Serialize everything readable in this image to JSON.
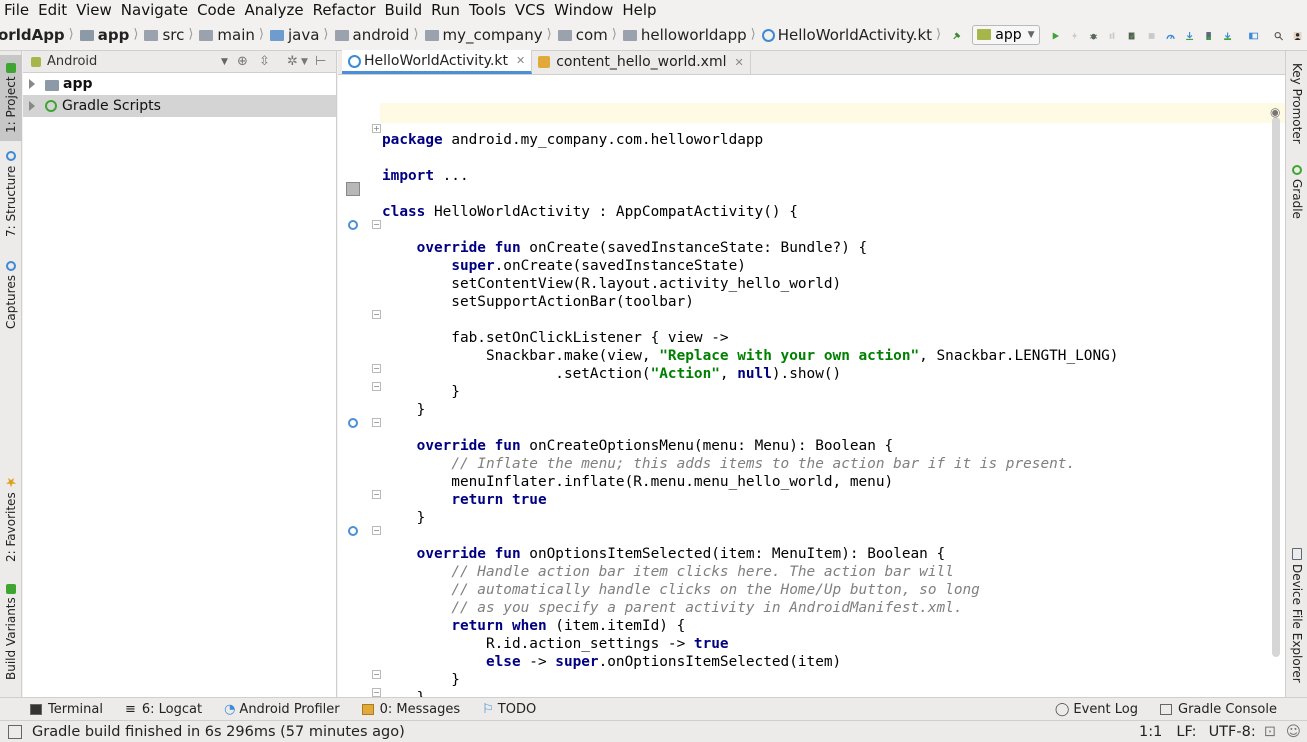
{
  "menu": [
    "File",
    "Edit",
    "View",
    "Navigate",
    "Code",
    "Analyze",
    "Refactor",
    "Build",
    "Run",
    "Tools",
    "VCS",
    "Window",
    "Help"
  ],
  "breadcrumb": [
    {
      "label": "orldApp",
      "icon": "none"
    },
    {
      "label": "app",
      "icon": "module-folder-icon"
    },
    {
      "label": "src",
      "icon": "folder-icon"
    },
    {
      "label": "main",
      "icon": "folder-icon"
    },
    {
      "label": "java",
      "icon": "source-folder-icon"
    },
    {
      "label": "android",
      "icon": "package-icon"
    },
    {
      "label": "my_company",
      "icon": "package-icon"
    },
    {
      "label": "com",
      "icon": "package-icon"
    },
    {
      "label": "helloworldapp",
      "icon": "package-icon"
    },
    {
      "label": "HelloWorldActivity.kt",
      "icon": "kotlin-class-icon"
    }
  ],
  "toolbar": {
    "run_config": "app"
  },
  "left_tabs": {
    "project": "1: Project",
    "structure": "7: Structure",
    "captures": "Captures",
    "favorites": "2: Favorites",
    "build_variants": "Build Variants"
  },
  "right_tabs": {
    "key_promoter": "Key Promoter",
    "gradle": "Gradle",
    "device_file_explorer": "Device File Explorer"
  },
  "project_panel": {
    "view_mode": "Android",
    "items": [
      {
        "label": "app"
      },
      {
        "label": "Gradle Scripts"
      }
    ]
  },
  "editor": {
    "tabs": [
      {
        "label": "HelloWorldActivity.kt",
        "active": true
      },
      {
        "label": "content_hello_world.xml",
        "active": false
      }
    ]
  },
  "code_lines": [
    "package android.my_company.com.helloworldapp",
    "",
    "import ...",
    "",
    "class HelloWorldActivity : AppCompatActivity() {",
    "",
    "    override fun onCreate(savedInstanceState: Bundle?) {",
    "        super.onCreate(savedInstanceState)",
    "        setContentView(R.layout.activity_hello_world)",
    "        setSupportActionBar(toolbar)",
    "",
    "        fab.setOnClickListener { view ->",
    "            Snackbar.make(view, \"Replace with your own action\", Snackbar.LENGTH_LONG)",
    "                    .setAction(\"Action\", null).show()",
    "        }",
    "    }",
    "",
    "    override fun onCreateOptionsMenu(menu: Menu): Boolean {",
    "        // Inflate the menu; this adds items to the action bar if it is present.",
    "        menuInflater.inflate(R.menu.menu_hello_world, menu)",
    "        return true",
    "    }",
    "",
    "    override fun onOptionsItemSelected(item: MenuItem): Boolean {",
    "        // Handle action bar item clicks here. The action bar will",
    "        // automatically handle clicks on the Home/Up button, so long",
    "        // as you specify a parent activity in AndroidManifest.xml.",
    "        return when (item.itemId) {",
    "            R.id.action_settings -> true",
    "            else -> super.onOptionsItemSelected(item)",
    "        }",
    "    }",
    "}"
  ],
  "bottom_tools": {
    "terminal": "Terminal",
    "logcat": "6: Logcat",
    "profiler": "Android Profiler",
    "messages": "0: Messages",
    "todo": "TODO",
    "event_log": "Event Log",
    "gradle_console": "Gradle Console"
  },
  "status": {
    "message": "Gradle build finished in 6s 296ms (57 minutes ago)",
    "position": "1:1",
    "line_sep": "LF:",
    "encoding": "UTF-8:"
  },
  "colors": {
    "keyword": "#000080",
    "string": "#008000",
    "comment": "#808080",
    "accent": "#4b8fd9"
  }
}
